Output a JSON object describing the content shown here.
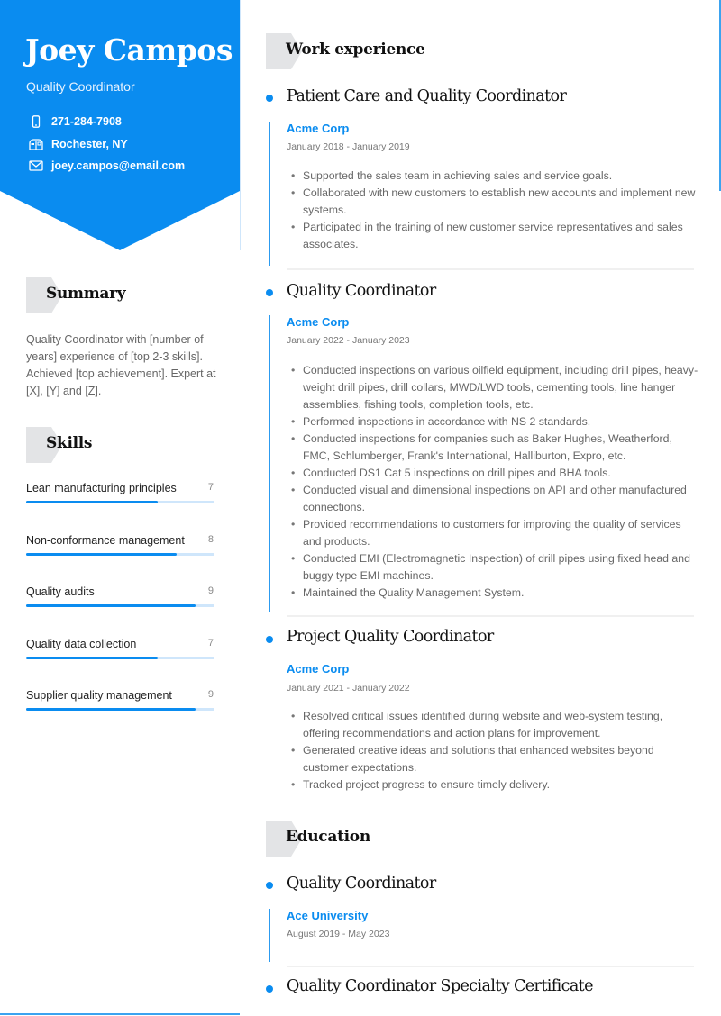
{
  "colors": {
    "accent": "#0A8CF0",
    "header_bg": "#0A8CF0",
    "section_tab": "#E3E4E6",
    "skill_track": "#CFE6FB"
  },
  "profile": {
    "name": "Joey Campos",
    "role": "Quality Coordinator",
    "contacts": [
      {
        "icon": "phone-icon",
        "text": "271-284-7908"
      },
      {
        "icon": "mailbox-icon",
        "text": "Rochester, NY"
      },
      {
        "icon": "envelope-icon",
        "text": "joey.campos@email.com"
      }
    ]
  },
  "summary": {
    "heading": "Summary",
    "text": "Quality Coordinator with [number of years] experience of [top 2-3 skills]. Achieved [top achievement]. Expert at [X], [Y] and [Z]."
  },
  "skills": {
    "heading": "Skills",
    "max": 10,
    "items": [
      {
        "label": "Lean manufacturing principles",
        "value": 7
      },
      {
        "label": "Non-conformance management",
        "value": 8
      },
      {
        "label": "Quality audits",
        "value": 9
      },
      {
        "label": "Quality data collection",
        "value": 7
      },
      {
        "label": "Supplier quality management",
        "value": 9
      }
    ]
  },
  "work": {
    "heading": "Work experience",
    "entries": [
      {
        "title": "Patient Care and Quality Coordinator",
        "company": "Acme Corp",
        "dates": "January 2018 - January 2019",
        "bullets": [
          "Supported the sales team in achieving sales and service goals.",
          "Collaborated with new customers to establish new accounts and implement new systems.",
          "Participated in the training of new customer service representatives and sales associates."
        ]
      },
      {
        "title": "Quality Coordinator",
        "company": "Acme Corp",
        "dates": "January 2022 - January 2023",
        "bullets": [
          "Conducted inspections on various oilfield equipment, including drill pipes, heavy-weight drill pipes, drill collars, MWD/LWD tools, cementing tools, line hanger assemblies, fishing tools, completion tools, etc.",
          "Performed inspections in accordance with NS 2 standards.",
          "Conducted inspections for companies such as Baker Hughes, Weatherford, FMC, Schlumberger, Frank's International, Halliburton, Expro, etc.",
          "Conducted DS1 Cat 5 inspections on drill pipes and BHA tools.",
          "Conducted visual and dimensional inspections on API and other manufactured connections.",
          "Provided recommendations to customers for improving the quality of services and products.",
          "Conducted EMI (Electromagnetic Inspection) of drill pipes using fixed head and buggy type EMI machines.",
          "Maintained the Quality Management System."
        ]
      },
      {
        "title": "Project Quality Coordinator",
        "company": "Acme Corp",
        "dates": "January 2021 - January 2022",
        "bullets": [
          "Resolved critical issues identified during website and web-system testing, offering recommendations and action plans for improvement.",
          "Generated creative ideas and solutions that enhanced websites beyond customer expectations.",
          "Tracked project progress to ensure timely delivery."
        ]
      }
    ]
  },
  "education": {
    "heading": "Education",
    "entries": [
      {
        "title": "Quality Coordinator",
        "institution": "Ace University",
        "dates": "August 2019 - May 2023"
      },
      {
        "title": "Quality Coordinator Specialty Certificate"
      }
    ]
  }
}
